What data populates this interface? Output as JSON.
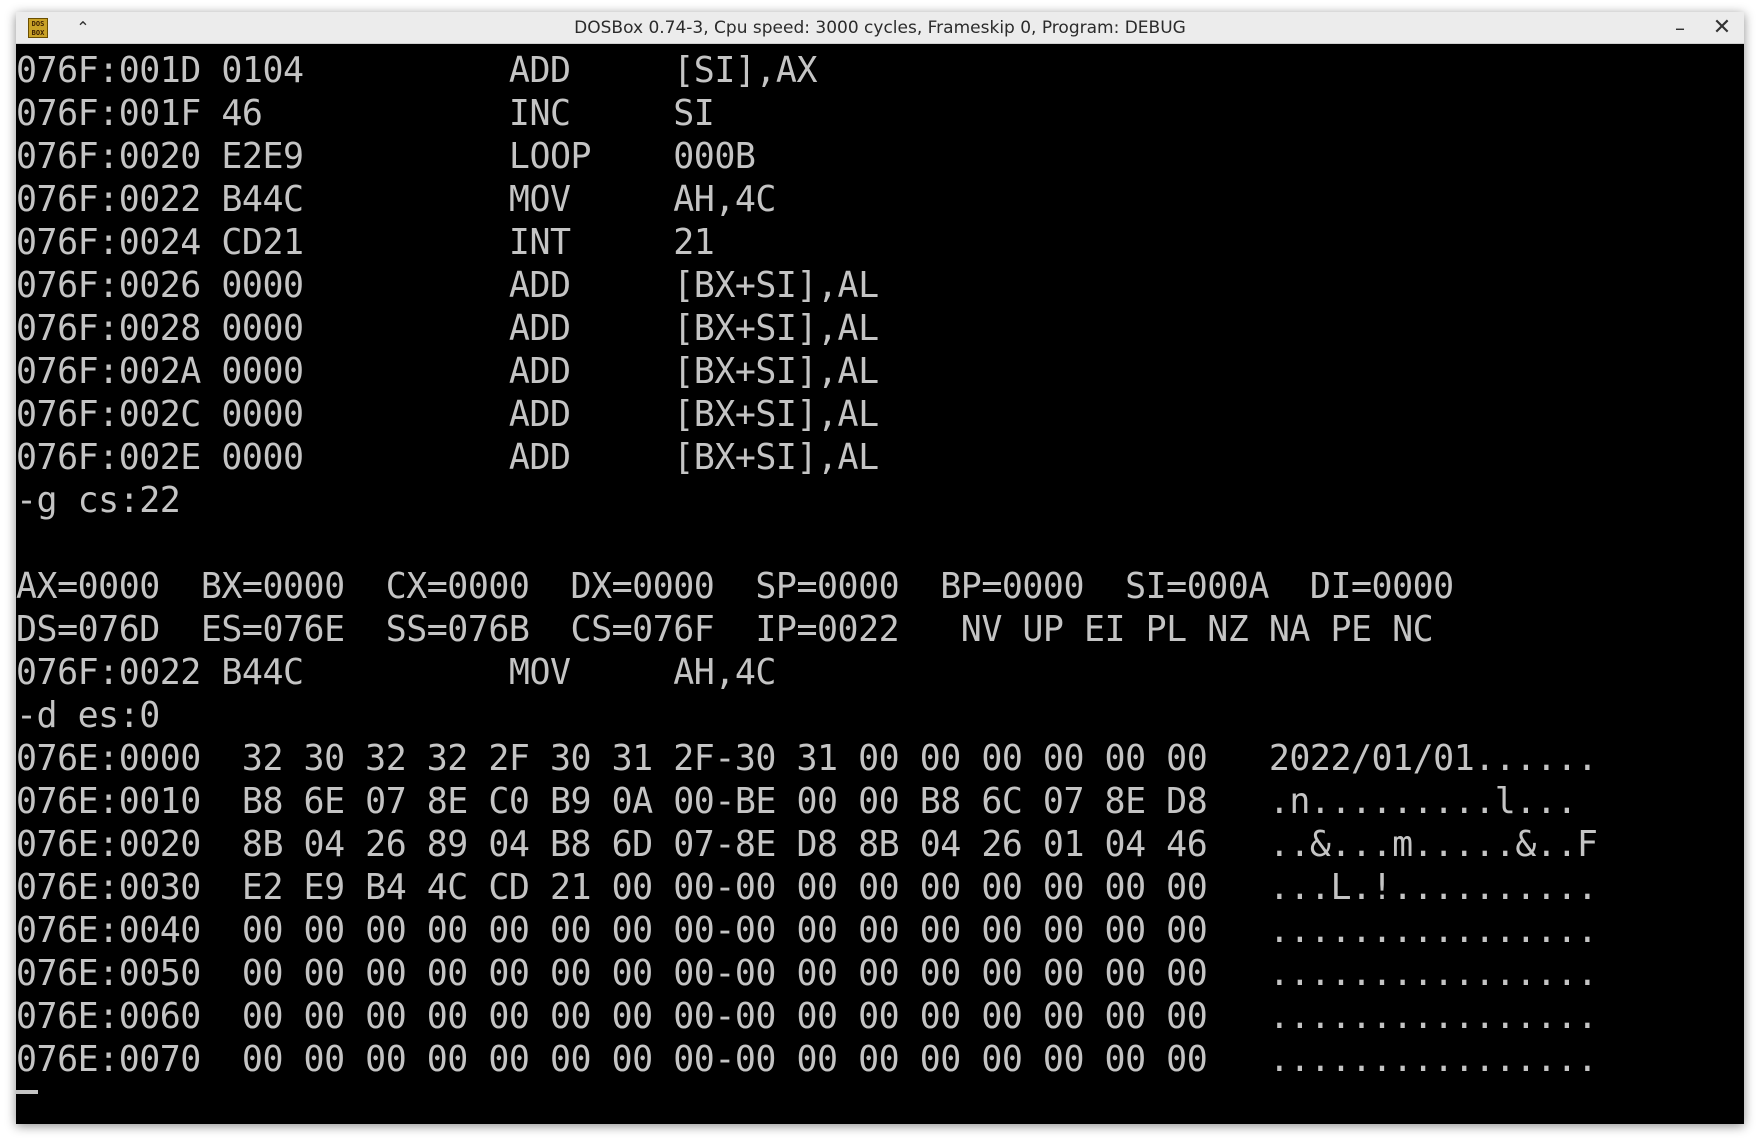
{
  "window": {
    "title": "DOSBox 0.74-3, Cpu speed: 3000 cycles, Frameskip 0, Program: DEBUG",
    "icon_text": "DOS BOX",
    "keep_above_icon": "chevron-up-double-icon",
    "minimize_icon": "minimize-icon",
    "close_icon": "close-icon"
  },
  "terminal": {
    "lines": [
      "076F:001D 0104          ADD     [SI],AX",
      "076F:001F 46            INC     SI",
      "076F:0020 E2E9          LOOP    000B",
      "076F:0022 B44C          MOV     AH,4C",
      "076F:0024 CD21          INT     21",
      "076F:0026 0000          ADD     [BX+SI],AL",
      "076F:0028 0000          ADD     [BX+SI],AL",
      "076F:002A 0000          ADD     [BX+SI],AL",
      "076F:002C 0000          ADD     [BX+SI],AL",
      "076F:002E 0000          ADD     [BX+SI],AL",
      "-g cs:22",
      "",
      "AX=0000  BX=0000  CX=0000  DX=0000  SP=0000  BP=0000  SI=000A  DI=0000",
      "DS=076D  ES=076E  SS=076B  CS=076F  IP=0022   NV UP EI PL NZ NA PE NC",
      "076F:0022 B44C          MOV     AH,4C",
      "-d es:0",
      "076E:0000  32 30 32 32 2F 30 31 2F-30 31 00 00 00 00 00 00   2022/01/01......",
      "076E:0010  B8 6E 07 8E C0 B9 0A 00-BE 00 00 B8 6C 07 8E D8   .n.........l...",
      "076E:0020  8B 04 26 89 04 B8 6D 07-8E D8 8B 04 26 01 04 46   ..&...m.....&..F",
      "076E:0030  E2 E9 B4 4C CD 21 00 00-00 00 00 00 00 00 00 00   ...L.!..........",
      "076E:0040  00 00 00 00 00 00 00 00-00 00 00 00 00 00 00 00   ................",
      "076E:0050  00 00 00 00 00 00 00 00-00 00 00 00 00 00 00 00   ................",
      "076E:0060  00 00 00 00 00 00 00 00-00 00 00 00 00 00 00 00   ................",
      "076E:0070  00 00 00 00 00 00 00 00-00 00 00 00 00 00 00 00   ................"
    ],
    "prompt_cursor": "_",
    "text_color": "#c4c4c4",
    "background_color": "#000000"
  }
}
